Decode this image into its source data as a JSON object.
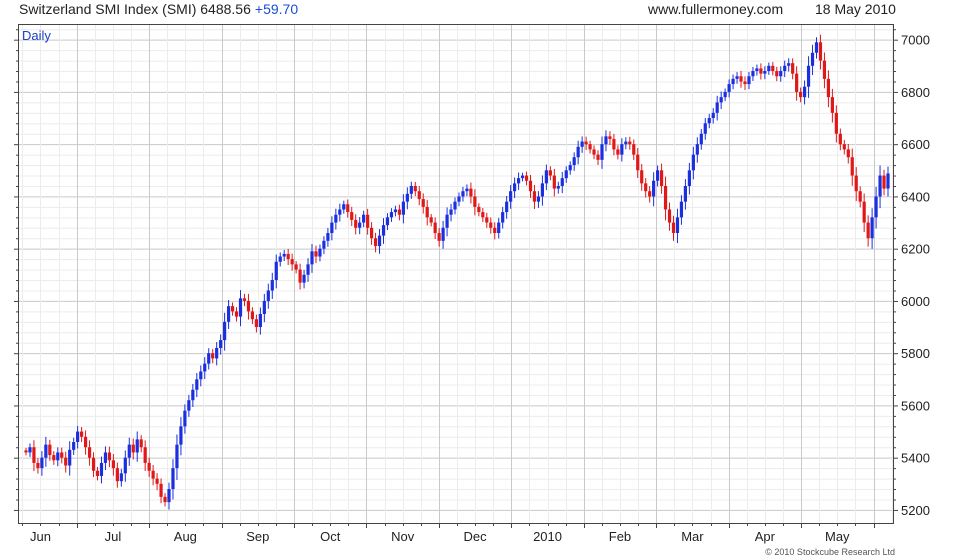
{
  "header": {
    "title": "Switzerland SMI Index (SMI) 6488.56",
    "change": "+59.70",
    "site": "www.fullermoney.com",
    "date": "18 May 2010"
  },
  "footer": {
    "copyright": "© 2010 Stockcube Research Ltd"
  },
  "chart_data": {
    "type": "candlestick",
    "period_label": "Daily",
    "ylim": [
      5150,
      7060
    ],
    "y_ticks": [
      5200,
      5400,
      5600,
      5800,
      6000,
      6200,
      6400,
      6600,
      6800,
      7000
    ],
    "x_tick_labels": [
      "Jun",
      "Jul",
      "Aug",
      "Sep",
      "Oct",
      "Nov",
      "Dec",
      "2010",
      "Feb",
      "Mar",
      "Apr",
      "May"
    ],
    "up_color": "#1a2fe0",
    "down_color": "#e01818",
    "grid": true,
    "closes": [
      5420,
      5440,
      5380,
      5360,
      5400,
      5450,
      5410,
      5390,
      5420,
      5400,
      5370,
      5430,
      5460,
      5500,
      5480,
      5440,
      5400,
      5350,
      5330,
      5380,
      5420,
      5390,
      5360,
      5310,
      5340,
      5400,
      5450,
      5420,
      5470,
      5440,
      5380,
      5350,
      5320,
      5300,
      5250,
      5230,
      5280,
      5360,
      5450,
      5520,
      5580,
      5620,
      5660,
      5700,
      5730,
      5760,
      5800,
      5780,
      5820,
      5850,
      5920,
      5980,
      5960,
      5940,
      6010,
      6000,
      5960,
      5930,
      5900,
      5950,
      6000,
      6040,
      6080,
      6150,
      6170,
      6180,
      6160,
      6140,
      6120,
      6070,
      6100,
      6140,
      6190,
      6170,
      6200,
      6230,
      6260,
      6300,
      6330,
      6350,
      6370,
      6340,
      6310,
      6280,
      6300,
      6330,
      6280,
      6240,
      6210,
      6250,
      6290,
      6320,
      6340,
      6350,
      6330,
      6380,
      6410,
      6440,
      6420,
      6390,
      6360,
      6320,
      6300,
      6260,
      6230,
      6280,
      6330,
      6350,
      6380,
      6400,
      6420,
      6430,
      6400,
      6360,
      6340,
      6320,
      6300,
      6280,
      6260,
      6300,
      6340,
      6380,
      6420,
      6450,
      6470,
      6480,
      6460,
      6420,
      6380,
      6400,
      6450,
      6500,
      6480,
      6430,
      6440,
      6470,
      6500,
      6520,
      6550,
      6590,
      6610,
      6600,
      6580,
      6560,
      6540,
      6600,
      6630,
      6620,
      6580,
      6560,
      6600,
      6610,
      6600,
      6560,
      6500,
      6450,
      6420,
      6400,
      6460,
      6500,
      6440,
      6350,
      6300,
      6260,
      6320,
      6380,
      6440,
      6500,
      6560,
      6600,
      6640,
      6680,
      6700,
      6720,
      6760,
      6780,
      6800,
      6830,
      6850,
      6860,
      6840,
      6830,
      6860,
      6880,
      6890,
      6870,
      6880,
      6900,
      6880,
      6860,
      6880,
      6900,
      6910,
      6870,
      6800,
      6780,
      6820,
      6900,
      6950,
      6990,
      6920,
      6850,
      6780,
      6720,
      6640,
      6600,
      6580,
      6550,
      6480,
      6420,
      6380,
      6300,
      6240,
      6320,
      6400,
      6480,
      6430,
      6488
    ]
  }
}
